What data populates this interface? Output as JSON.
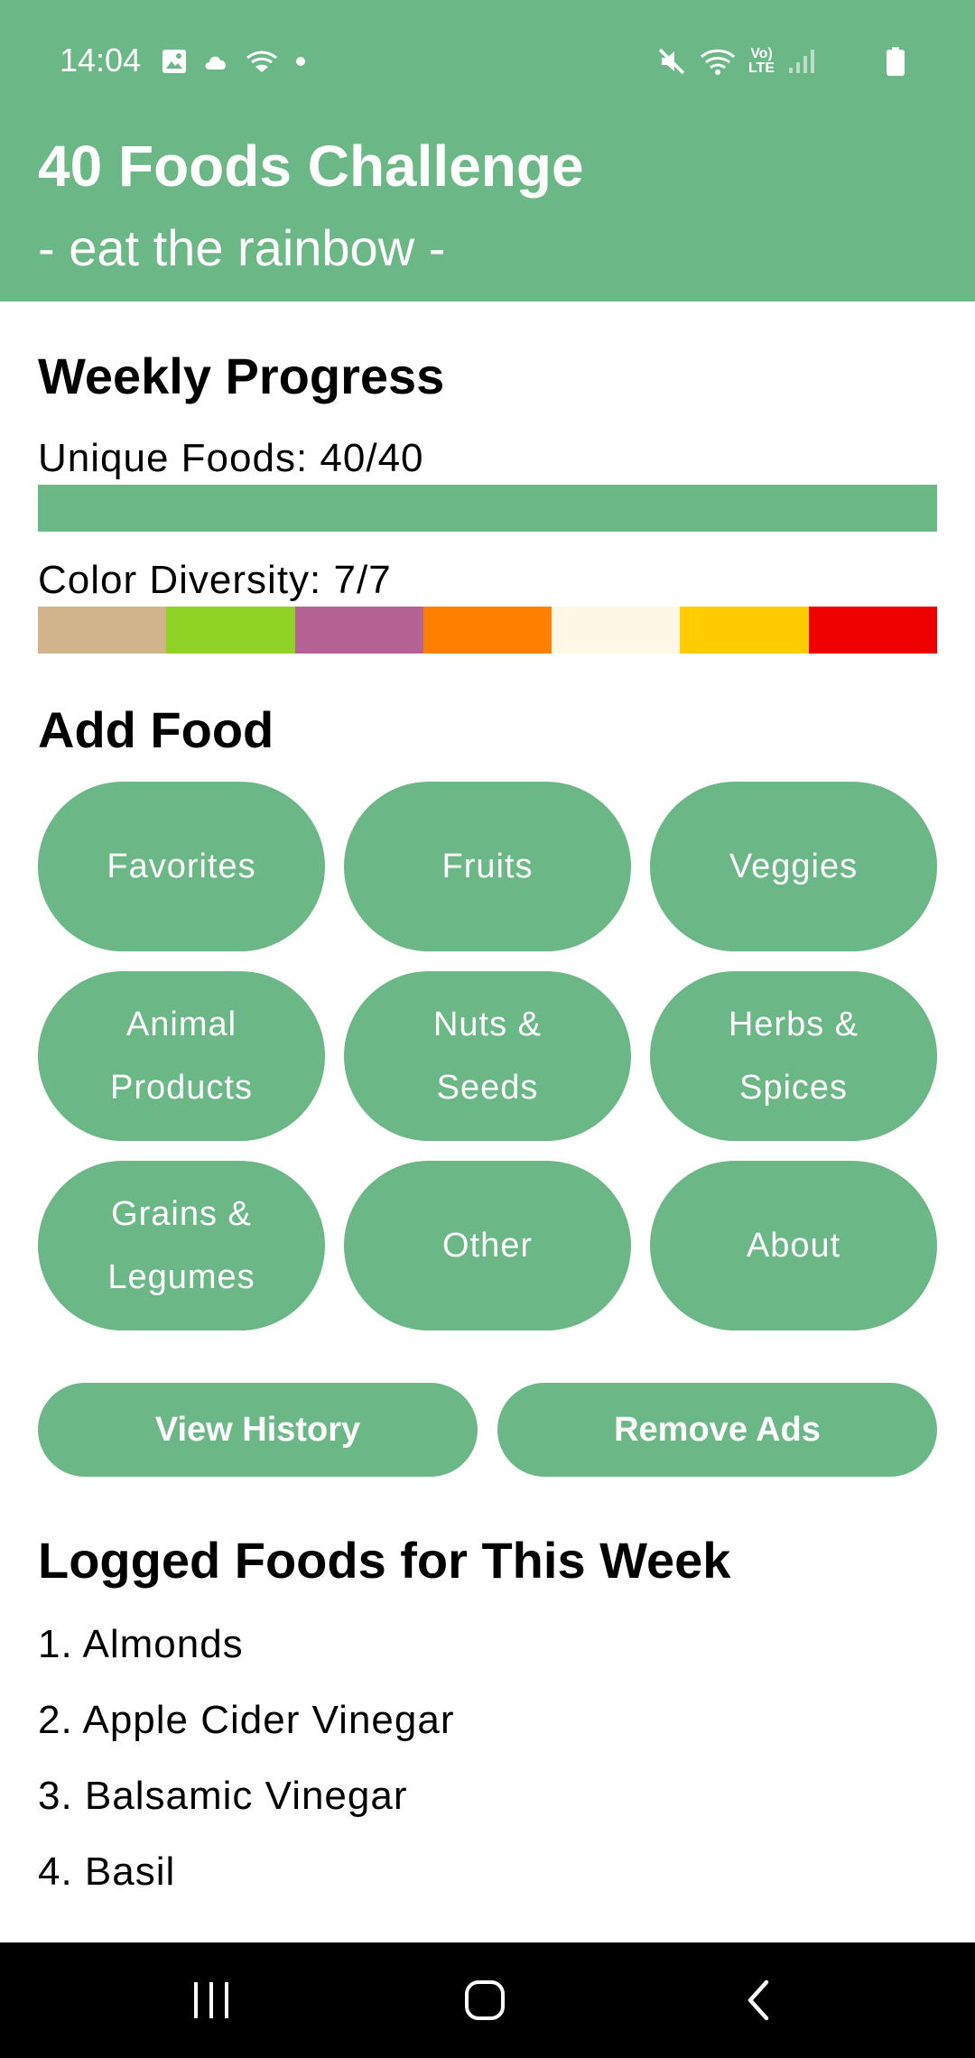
{
  "status_bar": {
    "time": "14:04",
    "left_icons": [
      "gallery-icon",
      "cloud-icon",
      "cast-icon",
      "dot-icon"
    ],
    "right_icons": [
      "mute-icon",
      "wifi-icon",
      "volte-icon",
      "signal-icon",
      "battery-icon"
    ],
    "volte_line1": "Vo)",
    "volte_line2": "LTE"
  },
  "header": {
    "title": "40 Foods Challenge",
    "subtitle": "- eat the rainbow -",
    "background": "#6bb785"
  },
  "weekly_progress": {
    "title": "Weekly Progress",
    "unique_foods_label": "Unique Foods: 40/40",
    "unique_foods_progress": 1.0,
    "color_diversity_label": "Color Diversity: 7/7",
    "colors": [
      "#d2b48c",
      "#8fd124",
      "#b46293",
      "#ff7f00",
      "#fff8e6",
      "#ffcc00",
      "#ee0000"
    ]
  },
  "add_food": {
    "title": "Add Food",
    "buttons": [
      {
        "label": "Favorites"
      },
      {
        "label": "Fruits"
      },
      {
        "label": "Veggies"
      },
      {
        "label": "Animal\nProducts"
      },
      {
        "label": "Nuts &\nSeeds"
      },
      {
        "label": "Herbs &\nSpices"
      },
      {
        "label": "Grains &\nLegumes"
      },
      {
        "label": "Other"
      },
      {
        "label": "About"
      }
    ]
  },
  "actions": {
    "view_history": "View History",
    "remove_ads": "Remove Ads"
  },
  "logged_foods": {
    "title": "Logged Foods for This Week",
    "items": [
      "1. Almonds",
      "2. Apple Cider Vinegar",
      "3. Balsamic Vinegar",
      "4. Basil"
    ]
  },
  "nav_bar": {
    "buttons": [
      "recent-apps-icon",
      "home-icon",
      "back-icon"
    ]
  },
  "accent_color": "#6bb785"
}
